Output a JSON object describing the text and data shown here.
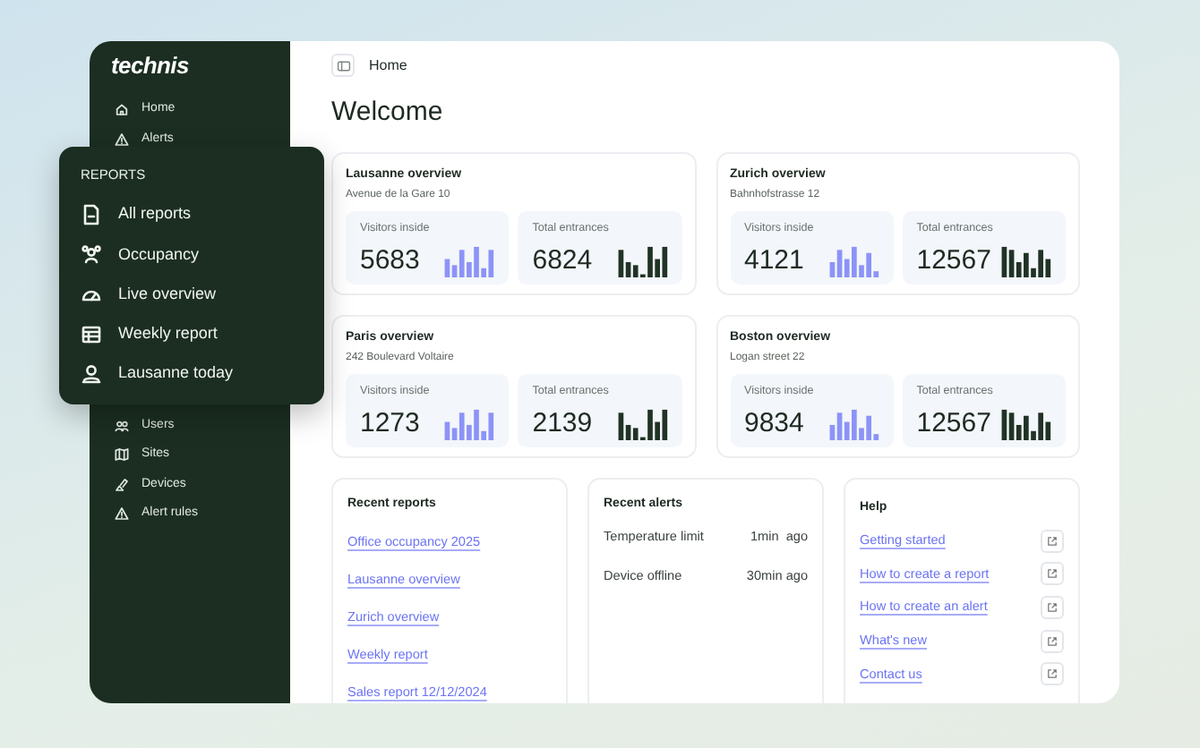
{
  "logo": "technis",
  "sidebar": {
    "top_items": [
      {
        "label": "Home"
      },
      {
        "label": "Alerts"
      }
    ],
    "bottom_items": [
      {
        "label": "Users"
      },
      {
        "label": "Sites"
      },
      {
        "label": "Devices"
      },
      {
        "label": "Alert rules"
      }
    ]
  },
  "reports_menu": {
    "heading": "REPORTS",
    "items": [
      {
        "label": "All reports"
      },
      {
        "label": "Occupancy"
      },
      {
        "label": "Live overview"
      },
      {
        "label": "Weekly report"
      },
      {
        "label": "Lausanne today"
      }
    ]
  },
  "breadcrumb": "Home",
  "heading": "Welcome",
  "sites": [
    {
      "title": "Lausanne overview",
      "address": "Avenue de la Gare 10",
      "stats": [
        {
          "kind": "visitors",
          "label": "Visitors inside",
          "value": "5683"
        },
        {
          "kind": "entrances",
          "label": "Total entrances",
          "value": "6824"
        }
      ]
    },
    {
      "title": "Zurich overview",
      "address": "Bahnhofstrasse 12",
      "stats": [
        {
          "kind": "visitors",
          "label": "Visitors inside",
          "value": "4121"
        },
        {
          "kind": "entrances",
          "label": "Total entrances",
          "value": "12567"
        }
      ]
    },
    {
      "title": "Paris overview",
      "address": "242 Boulevard Voltaire",
      "stats": [
        {
          "kind": "visitors",
          "label": "Visitors inside",
          "value": "1273"
        },
        {
          "kind": "entrances",
          "label": "Total entrances",
          "value": "2139"
        }
      ]
    },
    {
      "title": "Boston overview",
      "address": "Logan street 22",
      "stats": [
        {
          "kind": "visitors",
          "label": "Visitors inside",
          "value": "9834"
        },
        {
          "kind": "entrances",
          "label": "Total entrances",
          "value": "12567"
        }
      ]
    }
  ],
  "recent_reports": {
    "title": "Recent reports",
    "links": [
      "Office occupancy 2025",
      "Lausanne overview",
      "Zurich overview",
      "Weekly report",
      "Sales report 12/12/2024"
    ]
  },
  "recent_alerts": {
    "title": "Recent alerts",
    "items": [
      {
        "name": "Temperature limit",
        "time": "1min  ago"
      },
      {
        "name": "Device offline",
        "time": "30min ago"
      }
    ]
  },
  "help": {
    "title": "Help",
    "links": [
      "Getting started",
      "How to create a report",
      "How to create an alert",
      "What's new",
      "Contact us"
    ]
  }
}
